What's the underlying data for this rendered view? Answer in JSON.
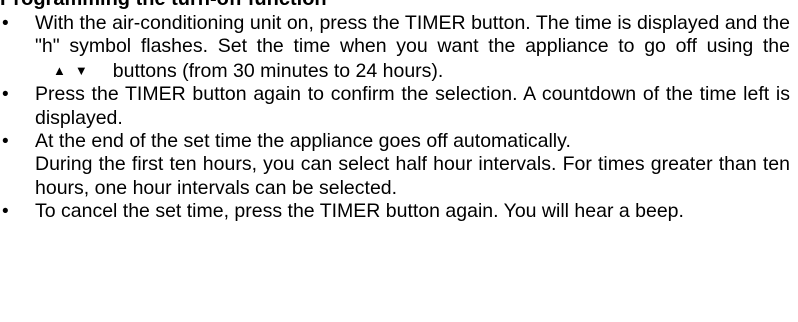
{
  "heading": "Programming the turn-off function",
  "bullet_glyph": "•",
  "items": [
    {
      "before": "With the air-conditioning unit on, press the TIMER button.  The time is displayed and the \"h\" symbol flashes.  Set the time when you want the appliance to go off using the",
      "after": "buttons (from 30 minutes to 24 hours).",
      "up_arrow": "▲",
      "down_arrow": "▼"
    },
    {
      "text": "Press the TIMER button again to confirm the selection. A countdown of the time left is displayed."
    },
    {
      "text": "At the end of the set time the appliance goes off automatically.",
      "text2": "During the first ten hours, you can select half hour intervals. For times greater than ten hours, one hour intervals can be selected."
    },
    {
      "text": "To cancel the set time, press the TIMER button again.  You will hear a beep."
    }
  ]
}
